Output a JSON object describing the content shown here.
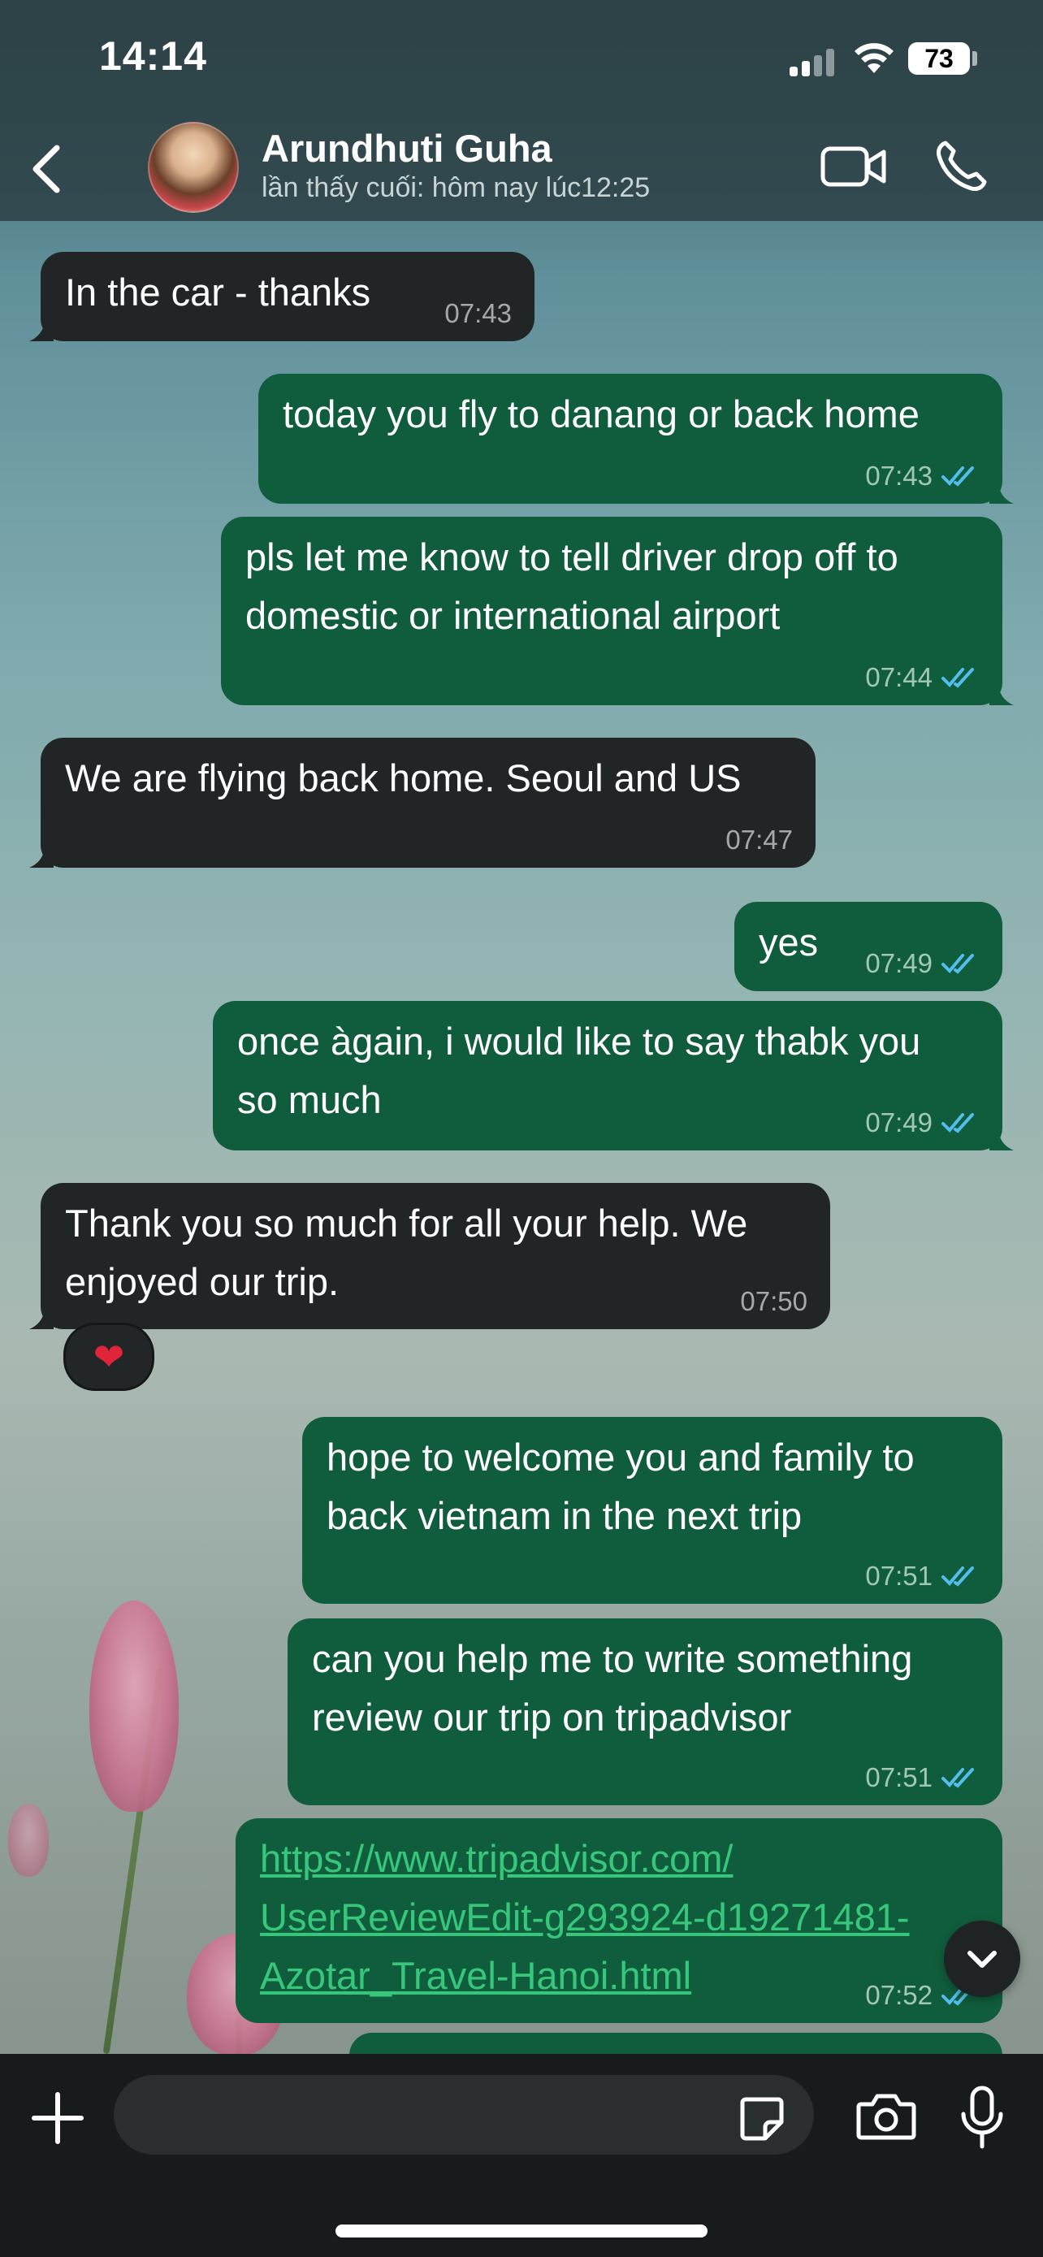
{
  "status_bar": {
    "time": "14:14",
    "battery": "73",
    "icons": [
      "cellular-signal-icon",
      "wifi-icon",
      "battery-icon"
    ]
  },
  "header": {
    "contact_name": "Arundhuti Guha",
    "last_seen": "lần thấy cuối: hôm nay lúc12:25",
    "icons": [
      "back-chevron-icon",
      "video-call-icon",
      "phone-icon"
    ]
  },
  "messages": [
    {
      "direction": "in",
      "text": "In the car - thanks",
      "time": "07:43"
    },
    {
      "direction": "out",
      "text": "today you fly to danang or back home",
      "time": "07:43",
      "status": "read"
    },
    {
      "direction": "out",
      "lines": [
        "pls let me know to tell driver drop off to",
        "domestic or international airport"
      ],
      "time": "07:44",
      "status": "read"
    },
    {
      "direction": "in",
      "text": "We are flying back home. Seoul and US",
      "time": "07:47"
    },
    {
      "direction": "out",
      "text": "yes",
      "time": "07:49",
      "status": "read"
    },
    {
      "direction": "out",
      "lines": [
        "once àgain, i would like to say thabk you",
        "so much"
      ],
      "time": "07:49",
      "status": "read"
    },
    {
      "direction": "in",
      "lines": [
        "Thank you so much for all your help. We",
        "enjoyed our trip."
      ],
      "time": "07:50",
      "reaction": "❤"
    },
    {
      "direction": "out",
      "lines": [
        "hope to welcome you and family to",
        "back vietnam in the next trip"
      ],
      "time": "07:51",
      "status": "read"
    },
    {
      "direction": "out",
      "lines": [
        "can you help me to write something",
        "review our trip on tripadvisor"
      ],
      "time": "07:51",
      "status": "read"
    },
    {
      "direction": "out",
      "link_lines": [
        "https://www.tripadvisor.com/",
        "UserReviewEdit-g293924-d19271481-",
        "Azotar_Travel-Hanoi.html"
      ],
      "time": "07:52",
      "status": "read"
    }
  ],
  "input": {
    "placeholder": "",
    "icons": [
      "plus-icon",
      "sticker-icon",
      "camera-icon",
      "microphone-icon"
    ]
  },
  "colors": {
    "incoming_bubble": "#222526",
    "outgoing_bubble": "#105d3d",
    "read_ticks": "#53bdeb",
    "link": "#37c77a"
  }
}
